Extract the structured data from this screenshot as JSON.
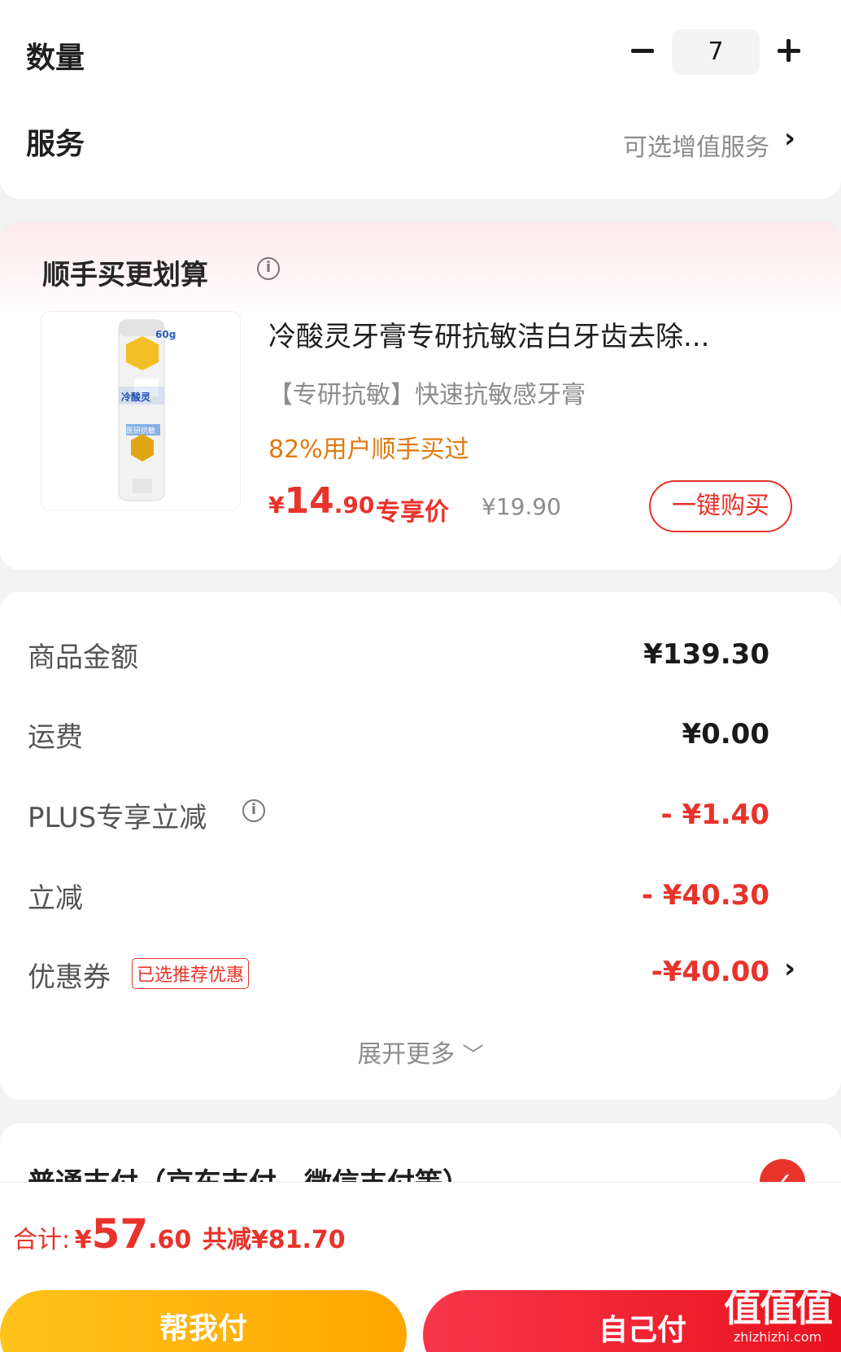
{
  "quantity": {
    "label": "数量",
    "value": "7"
  },
  "service": {
    "label": "服务",
    "value": "可选增值服务"
  },
  "addon": {
    "title": "顺手买更划算",
    "product_name": "冷酸灵牙膏专研抗敏洁白牙齿去除...",
    "product_subtitle": "【专研抗敏】快速抗敏感牙膏",
    "social_proof": "82%用户顺手买过",
    "price_symbol": "¥",
    "price_int": "14",
    "price_dec": ".90",
    "price_tag": "专享价",
    "original_price": "¥19.90",
    "buy_button": "一键购买",
    "image_texts": {
      "capacity": "60g",
      "brand": "冷酸灵",
      "line": "医研抗敏"
    }
  },
  "summary": {
    "goods_label": "商品金额",
    "goods_value": "¥139.30",
    "shipping_label": "运费",
    "shipping_value": "¥0.00",
    "plus_label": "PLUS专享立减",
    "plus_value": "- ¥1.40",
    "discount_label": "立减",
    "discount_value": "- ¥40.30",
    "coupon_label": "优惠券",
    "coupon_tag": "已选推荐优惠",
    "coupon_value": "-¥40.00",
    "expand": "展开更多"
  },
  "payment": {
    "label": "普通支付（京东支付、微信支付等）"
  },
  "bottom": {
    "total_label": "合计:",
    "total_symbol": "¥",
    "total_int": "57",
    "total_dec": ".60",
    "saved": "共减¥81.70",
    "help_pay": "帮我付",
    "self_pay": "自己付"
  },
  "watermark": {
    "logo": "值值值",
    "url": "zhizhizhi.com"
  },
  "colors": {
    "accent": "#e8332b",
    "orange": "#e07a10",
    "yellow_btn": "#ffb300"
  }
}
